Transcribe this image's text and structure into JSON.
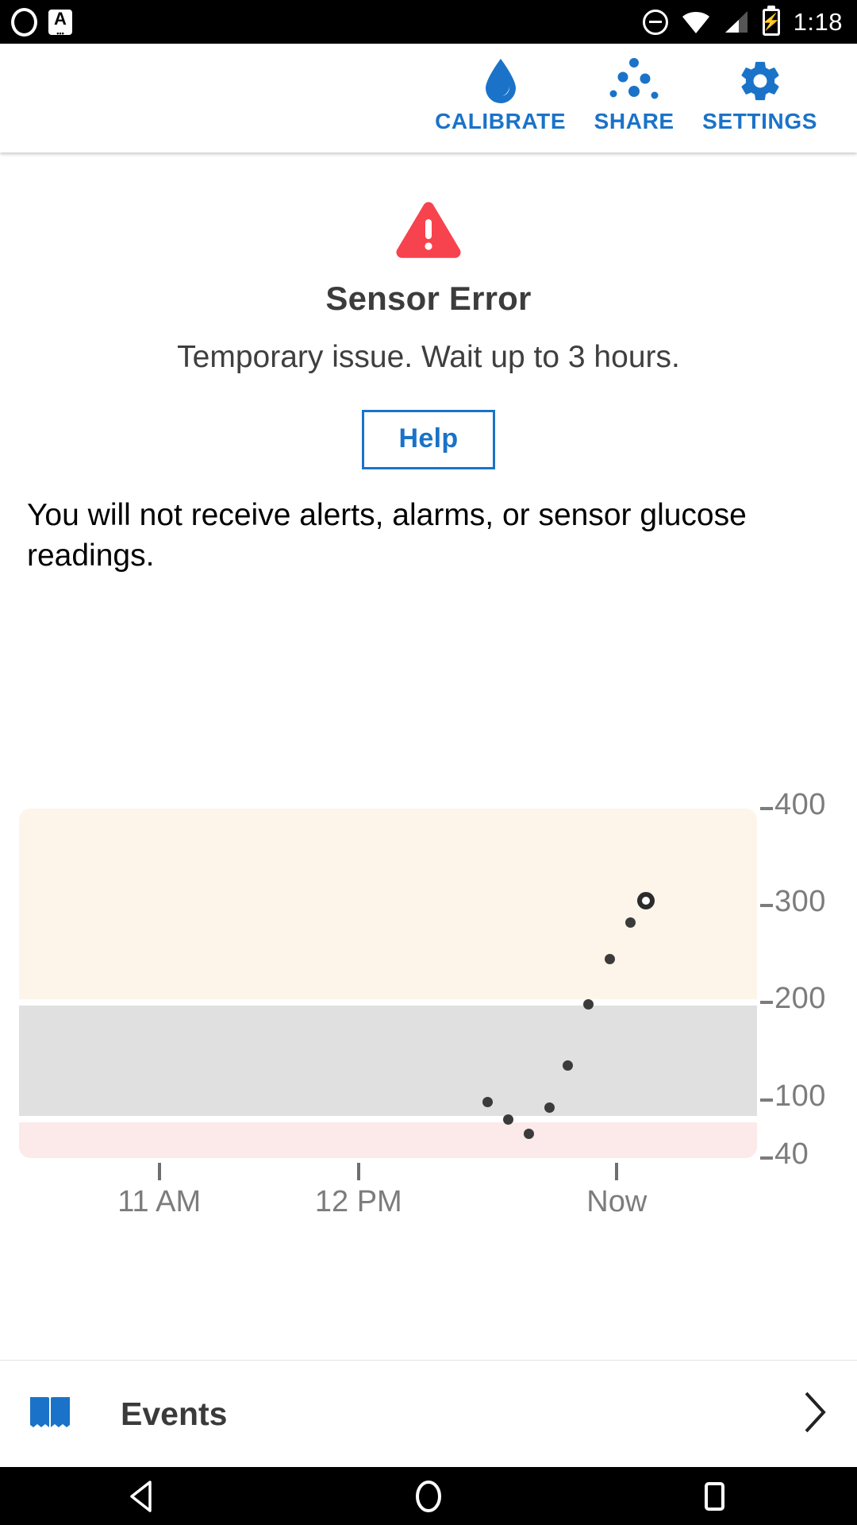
{
  "status_bar": {
    "time": "1:18",
    "left_icons": [
      "circle-outline-icon",
      "a-badge-icon"
    ],
    "right_icons": [
      "do-not-disturb-icon",
      "wifi-icon",
      "cellular-signal-icon",
      "battery-charging-icon"
    ],
    "battery_glyph": "⚡"
  },
  "action_bar": {
    "accent_color": "#1a73c8",
    "actions": [
      {
        "id": "calibrate",
        "label": "CALIBRATE",
        "icon": "blood-drop-icon"
      },
      {
        "id": "share",
        "label": "SHARE",
        "icon": "share-dots-icon"
      },
      {
        "id": "settings",
        "label": "SETTINGS",
        "icon": "gear-icon"
      }
    ]
  },
  "error": {
    "icon": "warning-triangle-icon",
    "icon_color": "#f7434d",
    "title": "Sensor Error",
    "subtitle": "Temporary issue. Wait up to 3 hours.",
    "help_label": "Help",
    "note": "You will not receive alerts, alarms, or sensor glucose readings."
  },
  "chart_data": {
    "type": "scatter",
    "title": "",
    "xlabel": "",
    "ylabel": "",
    "ylim": [
      40,
      400
    ],
    "xlim": [
      0,
      1
    ],
    "grid": false,
    "legend": null,
    "y_ticks": [
      "400",
      "300",
      "200",
      "100",
      "40"
    ],
    "y_tick_values": [
      400,
      300,
      200,
      100,
      40
    ],
    "x_ticks": [
      "11 AM",
      "12 PM",
      "Now"
    ],
    "x_tick_positions": [
      0.19,
      0.46,
      0.81
    ],
    "bands": [
      {
        "name": "high",
        "from": 200,
        "to": 400,
        "color": "#fdf5e9"
      },
      {
        "name": "target",
        "from": 80,
        "to": 200,
        "color": "#e0e0e0"
      },
      {
        "name": "low",
        "from": 40,
        "to": 80,
        "color": "#fceaea"
      }
    ],
    "series": [
      {
        "name": "Sensor glucose",
        "marker": "filled-dot",
        "points": [
          {
            "x": 0.635,
            "y": 98
          },
          {
            "x": 0.663,
            "y": 80
          },
          {
            "x": 0.691,
            "y": 65
          },
          {
            "x": 0.719,
            "y": 92
          },
          {
            "x": 0.744,
            "y": 135
          },
          {
            "x": 0.772,
            "y": 198
          },
          {
            "x": 0.8,
            "y": 245
          },
          {
            "x": 0.828,
            "y": 283
          }
        ]
      },
      {
        "name": "Current reading",
        "marker": "open-circle",
        "points": [
          {
            "x": 0.856,
            "y": 300
          }
        ]
      }
    ]
  },
  "events": {
    "icon": "open-book-icon",
    "label": "Events",
    "chevron": "chevron-right-icon"
  },
  "nav_bar": {
    "buttons": [
      {
        "id": "back",
        "icon": "back-triangle-icon"
      },
      {
        "id": "home",
        "icon": "home-circle-icon"
      },
      {
        "id": "recents",
        "icon": "recents-square-icon"
      }
    ]
  }
}
